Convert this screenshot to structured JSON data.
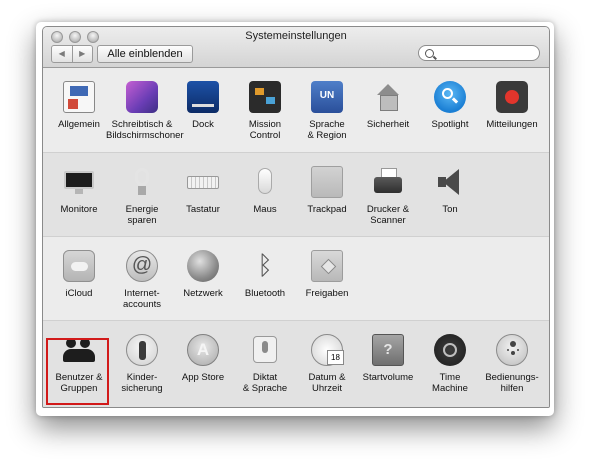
{
  "window": {
    "title": "Systemeinstellungen",
    "back_label": "◀",
    "forward_label": "▶",
    "show_all_label": "Alle einblenden",
    "search_value": "",
    "search_placeholder": ""
  },
  "highlight_color": "#d21a1a",
  "rows": [
    [
      {
        "label": "Allgemein",
        "icon": "general-icon"
      },
      {
        "label": "Schreibtisch &\nBildschirmschoner",
        "icon": "desktop-screensaver-icon"
      },
      {
        "label": "Dock",
        "icon": "dock-icon"
      },
      {
        "label": "Mission\nControl",
        "icon": "mission-control-icon"
      },
      {
        "label": "Sprache\n& Region",
        "icon": "language-region-icon"
      },
      {
        "label": "Sicherheit",
        "icon": "security-icon"
      },
      {
        "label": "Spotlight",
        "icon": "spotlight-icon"
      },
      {
        "label": "Mitteilungen",
        "icon": "notifications-icon"
      }
    ],
    [
      {
        "label": "Monitore",
        "icon": "displays-icon"
      },
      {
        "label": "Energie\nsparen",
        "icon": "energy-saver-icon"
      },
      {
        "label": "Tastatur",
        "icon": "keyboard-icon"
      },
      {
        "label": "Maus",
        "icon": "mouse-icon"
      },
      {
        "label": "Trackpad",
        "icon": "trackpad-icon"
      },
      {
        "label": "Drucker &\nScanner",
        "icon": "printer-scanner-icon"
      },
      {
        "label": "Ton",
        "icon": "sound-icon"
      }
    ],
    [
      {
        "label": "iCloud",
        "icon": "icloud-icon"
      },
      {
        "label": "Internet-\naccounts",
        "icon": "internet-accounts-icon"
      },
      {
        "label": "Netzwerk",
        "icon": "network-icon"
      },
      {
        "label": "Bluetooth",
        "icon": "bluetooth-icon"
      },
      {
        "label": "Freigaben",
        "icon": "sharing-icon"
      }
    ],
    [
      {
        "label": "Benutzer &\nGruppen",
        "icon": "users-groups-icon"
      },
      {
        "label": "Kinder-\nsicherung",
        "icon": "parental-controls-icon"
      },
      {
        "label": "App Store",
        "icon": "app-store-icon"
      },
      {
        "label": "Diktat\n& Sprache",
        "icon": "dictation-speech-icon"
      },
      {
        "label": "Datum &\nUhrzeit",
        "icon": "date-time-icon"
      },
      {
        "label": "Startvolume",
        "icon": "startup-disk-icon"
      },
      {
        "label": "Time\nMachine",
        "icon": "time-machine-icon"
      },
      {
        "label": "Bedienungs-\nhilfen",
        "icon": "accessibility-icon"
      }
    ]
  ]
}
